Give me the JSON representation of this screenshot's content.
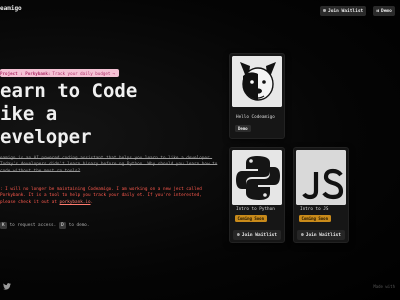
{
  "header": {
    "logo": "eamigo",
    "join_waitlist": "Join Waitlist",
    "demo": "Demo"
  },
  "banner": {
    "project_label": "Project : Porkybank:",
    "tagline": "Track your daily budget",
    "arrow": "→"
  },
  "hero": {
    "line1": "earn to Code",
    "line2": "ike a",
    "line3": "eveloper",
    "description": "eamigo is an AI powered coding assistant that helps you learn to  like a developer. Today's developers didn't learn binary before  ng Python. Why should you learn how to code without the most  rn tools?",
    "notice_before": ": I will no longer be maintaining Codeamigo. I am working on a new  ject called Porkybank. It is a tool to help you track your daily  et. If you're interested, please check it out at ",
    "notice_link": "porkybank.io",
    "notice_after": "."
  },
  "shortcut": {
    "key1": "K",
    "middle": "to request access.",
    "key2": "D",
    "end": "to demo."
  },
  "cards": [
    {
      "title": "Hello Codeamigo",
      "badge": "Demo",
      "icon": "dog-icon"
    },
    {
      "title": "Intro to Python",
      "badge": "Coming Soon",
      "button": "Join Waitlist",
      "icon": "python-icon"
    },
    {
      "title": "Intro to JS",
      "badge": "Coming Soon",
      "button": "Join Waitlist",
      "icon": "js-icon"
    }
  ],
  "footer": {
    "twitter_icon": "twitter-icon",
    "right_text": "Made with"
  },
  "colors": {
    "banner_bg": "#f4c2d4",
    "notice": "#ff5a4e",
    "coming_soon": "#c88a1a"
  }
}
